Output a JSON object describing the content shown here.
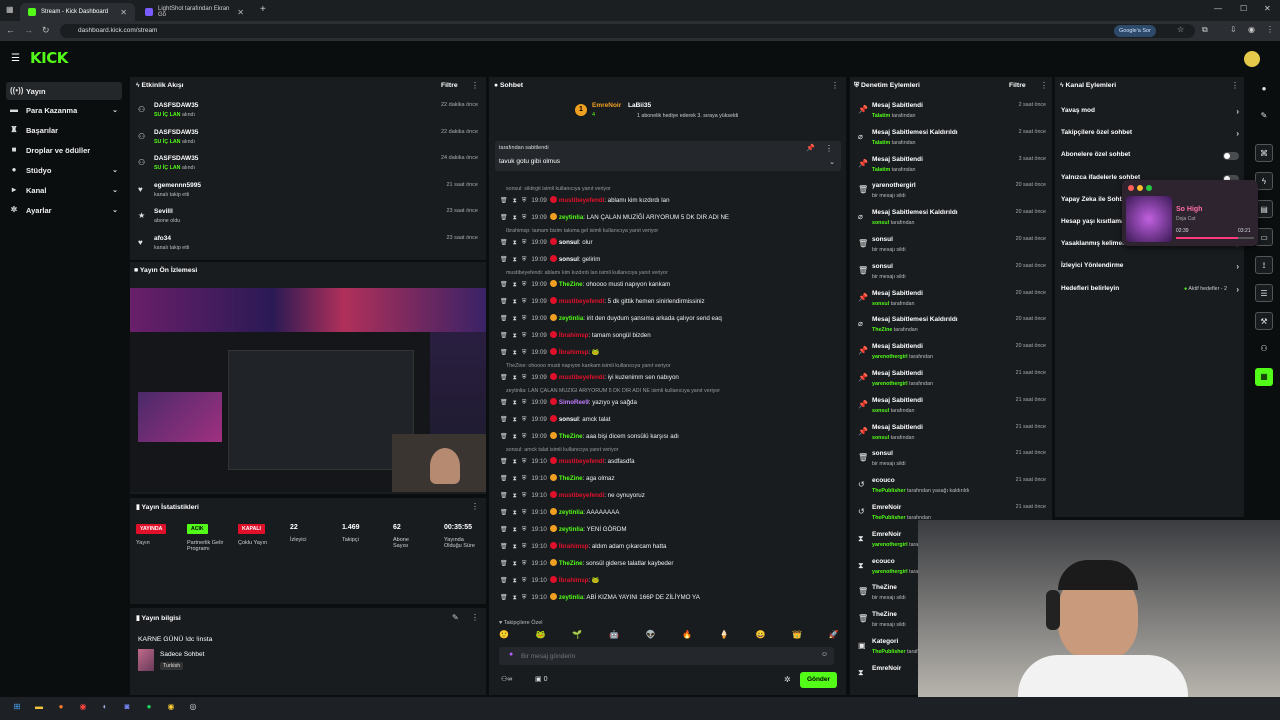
{
  "browser": {
    "tabs": [
      {
        "title": "Stream - Kick Dashboard",
        "active": true
      },
      {
        "title": "LightShot tarafından Ekran Gö",
        "active": false
      }
    ],
    "url": "dashboard.kick.com/stream",
    "google_button": "Google'a Sor"
  },
  "brand": {
    "logo": "KICK",
    "accent": "#53fc18"
  },
  "sidebar": {
    "items": [
      {
        "label": "Yayın",
        "icon": "broadcast-icon",
        "active": true,
        "chevron": false
      },
      {
        "label": "Para Kazanma",
        "icon": "money-icon",
        "active": false,
        "chevron": true
      },
      {
        "label": "Başarılar",
        "icon": "trophy-icon",
        "active": false,
        "chevron": false
      },
      {
        "label": "Droplar ve ödüller",
        "icon": "gift-icon",
        "active": false,
        "chevron": false
      },
      {
        "label": "Stüdyo",
        "icon": "studio-icon",
        "active": false,
        "chevron": true
      },
      {
        "label": "Kanal",
        "icon": "channel-icon",
        "active": false,
        "chevron": true
      },
      {
        "label": "Ayarlar",
        "icon": "gear-icon",
        "active": false,
        "chevron": true
      }
    ]
  },
  "activity": {
    "title": "Etkinlik Akışı",
    "filter": "Filtre",
    "items": [
      {
        "icon": "gift-sub-icon",
        "name": "DASFSDAW35",
        "sub_b": "SU İÇ LAN",
        "sub": "alındı",
        "time": "22 dakika önce"
      },
      {
        "icon": "gift-sub-icon",
        "name": "DASFSDAW35",
        "sub_b": "SU İÇ LAN",
        "sub": "alındı",
        "time": "22 dakika önce"
      },
      {
        "icon": "gift-sub-icon",
        "name": "DASFSDAW35",
        "sub_b": "SU İÇ LAN",
        "sub": "alındı",
        "time": "24 dakika önce"
      },
      {
        "icon": "heart-icon",
        "name": "egemennn5995",
        "sub_b": "",
        "sub": "kanalı takip etti",
        "time": "21 saat önce"
      },
      {
        "icon": "star-icon",
        "name": "Sevilll",
        "sub_b": "",
        "sub": "abone oldu",
        "time": "23 saat önce"
      },
      {
        "icon": "heart-icon",
        "name": "afo34",
        "sub_b": "",
        "sub": "kanalı takip etti",
        "time": "23 saat önce"
      }
    ]
  },
  "preview": {
    "title": "Yayın Ön İzlemesi"
  },
  "stats": {
    "title": "Yayın İstatistikleri",
    "items": [
      {
        "badge": "YAYINDA",
        "badge_color": "#e0102a",
        "label": "Yayın"
      },
      {
        "badge": "ACIK",
        "badge_color": "#53fc18",
        "label": "Partnerlik Gelir Programı"
      },
      {
        "badge": "KAPALI",
        "badge_color": "#e0102a",
        "label": "Çoklu Yayın"
      },
      {
        "value": "22",
        "label": "İzleyici"
      },
      {
        "value": "1.469",
        "label": "Takipçi"
      },
      {
        "value": "62",
        "label": "Abone Sayısı"
      },
      {
        "value": "00:35:55",
        "label": "Yayında Olduğu Süre"
      }
    ]
  },
  "info": {
    "title": "Yayın bilgisi",
    "stream_title": "KARNE GÜNÜ !dc !insta",
    "category": "Sadece Sohbet",
    "language": "Turkish"
  },
  "chat": {
    "title": "Sohbet",
    "top_gifter": {
      "name": "EmreNoir",
      "count": "4"
    },
    "gift_user": "LaBii35",
    "gift_text": "1 abonelik hediye ederek 3. sıraya yükseldi",
    "pinned_by_text": "tarafından sabitlendi",
    "pinned_msg": "tavuk gotu gibi olmus",
    "messages": [
      {
        "reply": "sonsul: siktirgit isimli kullanıcıya yanıt veriyor"
      },
      {
        "time": "19:09",
        "user": "mustibeyefendi",
        "color": "#e0102a",
        "msg": ": ablamı kim kızdırdı lan"
      },
      {
        "time": "19:09",
        "user": "zeytinlia",
        "color": "#53fc18",
        "msg": ": LAN ÇALAN MUZİĞİ ARIYORUM 5 DK DIR ADI NE"
      },
      {
        "reply": "İbrahimsp: tamam bizim takıma gel isimli kullanıcıya yanıt veriyor"
      },
      {
        "time": "19:09",
        "user": "sonsul",
        "color": "#ffffff",
        "msg": ": olur"
      },
      {
        "time": "19:09",
        "user": "sonsul",
        "color": "#ffffff",
        "msg": ": gelirim"
      },
      {
        "reply": "mustibeyefendi: ablamı kim kızdırdı lan isimli kullanıcıya yanıt veriyor"
      },
      {
        "time": "19:09",
        "user": "TheZine",
        "color": "#53fc18",
        "msg": ": ohoooo musti napıyon kankam"
      },
      {
        "time": "19:09",
        "user": "mustibeyefendi",
        "color": "#e0102a",
        "msg": ": 5 dk gittik hemen sinirlendirmissiniz"
      },
      {
        "time": "19:09",
        "user": "zeytinlia",
        "color": "#53fc18",
        "msg": ": irit den duydum şansıma arkada çalıyor send eaq"
      },
      {
        "time": "19:09",
        "user": "İbrahimsp",
        "color": "#e0102a",
        "msg": ": tamam songül bizden"
      },
      {
        "time": "19:09",
        "user": "İbrahimsp",
        "color": "#e0102a",
        "msg": ": 🐸"
      },
      {
        "reply": "TheZine: ohoooo musti napıyon kankam isimli kullanıcıya yanıt veriyor"
      },
      {
        "time": "19:09",
        "user": "mustibeyefendi",
        "color": "#e0102a",
        "msg": ": iyi kuzenimm sen nabıyon"
      },
      {
        "reply": "zeytinlia: LAN ÇALAN MUZİĞİ ARIYORUM 5 DK DIR ADI NE isimli kullanıcıya yanıt veriyor"
      },
      {
        "time": "19:09",
        "user": "SimoRee9",
        "color": "#c27cff",
        "msg": ": yazıyo ya sağda"
      },
      {
        "time": "19:09",
        "user": "sonsul",
        "color": "#ffffff",
        "msg": ": amck talat"
      },
      {
        "time": "19:09",
        "user": "TheZine",
        "color": "#53fc18",
        "msg": ": aaa bişi dicem sonsülü karşısı adı"
      },
      {
        "reply": "sonsul: amck talat isimli kullanıcıya yanıt veriyor"
      },
      {
        "time": "19:10",
        "user": "mustibeyefendi",
        "color": "#e0102a",
        "msg": ": asdfasdfa"
      },
      {
        "time": "19:10",
        "user": "TheZine",
        "color": "#53fc18",
        "msg": ": aga olmaz"
      },
      {
        "time": "19:10",
        "user": "mustibeyefendi",
        "color": "#e0102a",
        "msg": ": ne oynuyoruz"
      },
      {
        "time": "19:10",
        "user": "zeytinlia",
        "color": "#53fc18",
        "msg": ": AAAAAAAA"
      },
      {
        "time": "19:10",
        "user": "zeytinlia",
        "color": "#53fc18",
        "msg": ": YENİ GÖRDM"
      },
      {
        "time": "19:10",
        "user": "İbrahimsp",
        "color": "#e0102a",
        "msg": ": aldım adam çıkarcam hatta"
      },
      {
        "time": "19:10",
        "user": "TheZine",
        "color": "#53fc18",
        "msg": ": sonsül giderse talatlar kaybeder"
      },
      {
        "time": "19:10",
        "user": "İbrahimsp",
        "color": "#e0102a",
        "msg": ": 🐸"
      },
      {
        "time": "19:10",
        "user": "zeytinlia",
        "color": "#53fc18",
        "msg": ": ABİ KIZMA YAYINI 166P DE ZİLİYMO YA"
      }
    ],
    "followers_only": "Takipçilere Özel",
    "input_placeholder": "Bir mesaj gönderin",
    "send": "Gönder",
    "points": "0"
  },
  "moderation": {
    "title": "Denetim Eylemleri",
    "filter": "Filtre",
    "items": [
      {
        "icon": "pin-icon",
        "name": "Mesaj Sabitlendi",
        "by": "Talatim",
        "sub": "tarafından",
        "time": "2 saat önce"
      },
      {
        "icon": "unpin-icon",
        "name": "Mesaj Sabitlemesi Kaldırıldı",
        "by": "Talatim",
        "sub": "tarafından",
        "time": "2 saat önce"
      },
      {
        "icon": "pin-icon",
        "name": "Mesaj Sabitlendi",
        "by": "Talatim",
        "sub": "tarafından",
        "time": "3 saat önce"
      },
      {
        "icon": "trash-icon",
        "name": "yarenothergirl",
        "by": "",
        "sub": "bir mesajı sildi",
        "time": "20 saat önce"
      },
      {
        "icon": "unpin-icon",
        "name": "Mesaj Sabitlemesi Kaldırıldı",
        "by": "sonsul",
        "sub": "tarafından",
        "time": "20 saat önce"
      },
      {
        "icon": "trash-icon",
        "name": "sonsul",
        "by": "",
        "sub": "bir mesajı sildi",
        "time": "20 saat önce"
      },
      {
        "icon": "trash-icon",
        "name": "sonsul",
        "by": "",
        "sub": "bir mesajı sildi",
        "time": "20 saat önce"
      },
      {
        "icon": "pin-icon",
        "name": "Mesaj Sabitlendi",
        "by": "sonsul",
        "sub": "tarafından",
        "time": "20 saat önce"
      },
      {
        "icon": "unpin-icon",
        "name": "Mesaj Sabitlemesi Kaldırıldı",
        "by": "TheZine",
        "sub": "tarafından",
        "time": "20 saat önce"
      },
      {
        "icon": "pin-icon",
        "name": "Mesaj Sabitlendi",
        "by": "yarenothergirl",
        "sub": "tarafından",
        "time": "20 saat önce"
      },
      {
        "icon": "pin-icon",
        "name": "Mesaj Sabitlendi",
        "by": "yarenothergirl",
        "sub": "tarafından",
        "time": "21 saat önce"
      },
      {
        "icon": "pin-icon",
        "name": "Mesaj Sabitlendi",
        "by": "sonsul",
        "sub": "tarafından",
        "time": "21 saat önce"
      },
      {
        "icon": "pin-icon",
        "name": "Mesaj Sabitlendi",
        "by": "sonsul",
        "sub": "tarafından",
        "time": "21 saat önce"
      },
      {
        "icon": "trash-icon",
        "name": "sonsul",
        "by": "",
        "sub": "bir mesajı sildi",
        "time": "21 saat önce"
      },
      {
        "icon": "unban-icon",
        "name": "ecouco",
        "by": "ThePublisher",
        "sub": "tarafından yasağı kaldırıldı",
        "time": "21 saat önce"
      },
      {
        "icon": "unban-icon",
        "name": "EmreNoir",
        "by": "ThePublisher",
        "sub": "tarafından",
        "time": "21 saat önce"
      },
      {
        "icon": "timeout-icon",
        "name": "EmreNoir",
        "by": "yarenothergirl",
        "sub": "tarafından uzaklaştırıldı",
        "time": ""
      },
      {
        "icon": "timeout-icon",
        "name": "ecouco",
        "by": "yarenothergirl",
        "sub": "tarafından uzaklaştırıldı",
        "time": ""
      },
      {
        "icon": "trash-icon",
        "name": "TheZine",
        "by": "",
        "sub": "bir mesajı sildi",
        "time": ""
      },
      {
        "icon": "trash-icon",
        "name": "TheZine",
        "by": "",
        "sub": "bir mesajı sildi",
        "time": ""
      },
      {
        "icon": "category-icon",
        "name": "Kategori",
        "by": "ThePublisher",
        "sub": "tarafından",
        "time": ""
      },
      {
        "icon": "timeout-icon",
        "name": "EmreNoir",
        "by": "",
        "sub": "",
        "time": ""
      }
    ]
  },
  "channel_actions": {
    "title": "Kanal Eylemleri",
    "items": [
      {
        "label": "Yavaş mod",
        "type": "arrow"
      },
      {
        "label": "Takipçilere özel sohbet",
        "type": "arrow"
      },
      {
        "label": "Abonelere özel sohbet",
        "type": "toggle"
      },
      {
        "label": "Yalnızca ifadelerle sohbet",
        "type": "toggle"
      },
      {
        "label": "Yapay Zeka ile Sohbet Moderasyonu",
        "type": "arrow"
      },
      {
        "label": "Hesap yaşı kısıtlaması",
        "type": "arrow"
      },
      {
        "label": "Yasaklanmış kelimeler",
        "type": "arrow"
      },
      {
        "label": "İzleyici Yönlendirme",
        "type": "arrow"
      },
      {
        "label": "Hedefleri belirleyin",
        "type": "arrow",
        "extra": "Aktif hedefler - 2"
      }
    ]
  },
  "media_player": {
    "title": "So High",
    "artist": "Doja Cat",
    "elapsed": "02:39",
    "total": "03:21",
    "progress": 0.79
  },
  "taskbar": {
    "icons": [
      "windows-icon",
      "folder-icon",
      "firefox-icon",
      "chrome-icon",
      "steam-icon",
      "discord-icon",
      "spotify-icon",
      "chrome-icon",
      "obs-icon"
    ]
  }
}
